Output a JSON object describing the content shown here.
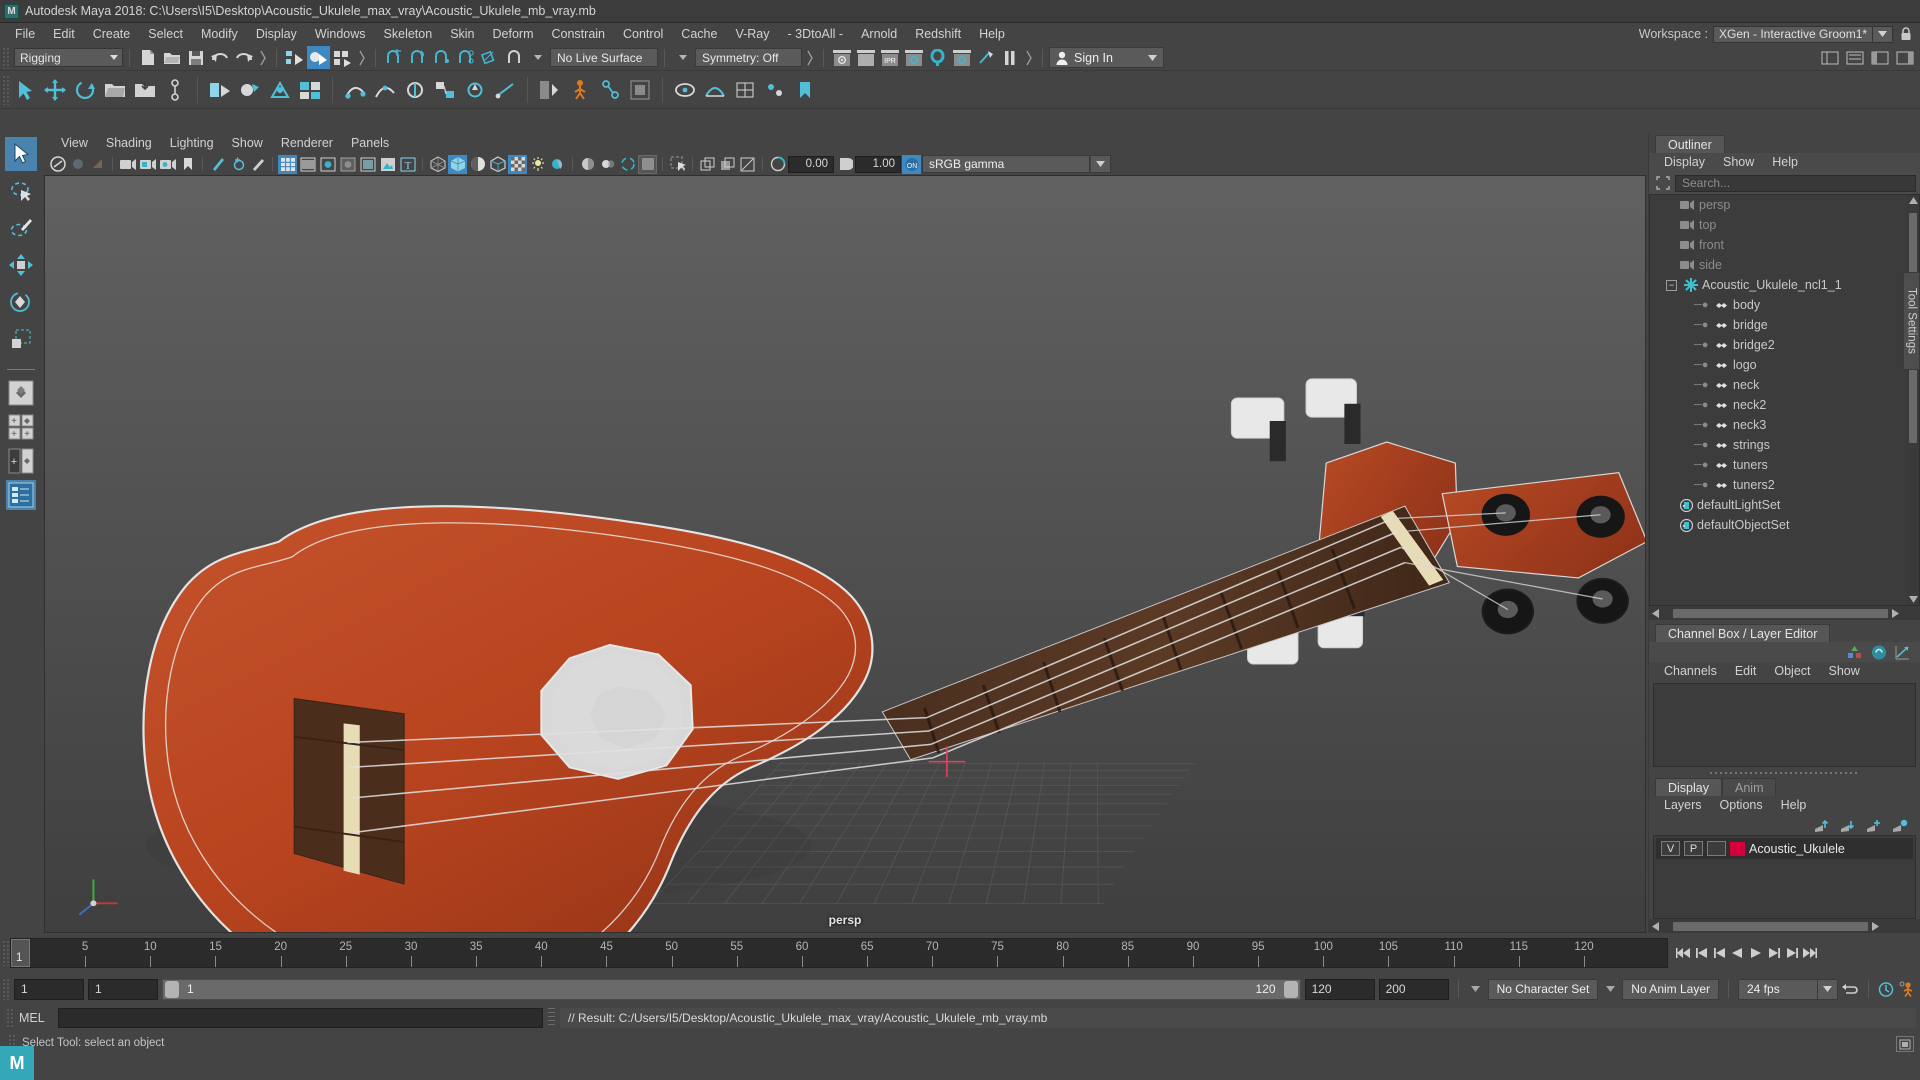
{
  "window": {
    "title": "Autodesk Maya 2018: C:\\Users\\I5\\Desktop\\Acoustic_Ukulele_max_vray\\Acoustic_Ukulele_mb_vray.mb",
    "logo_text": "M"
  },
  "menubar": {
    "items": [
      "File",
      "Edit",
      "Create",
      "Select",
      "Modify",
      "Display",
      "Windows",
      "Skeleton",
      "Skin",
      "Deform",
      "Constrain",
      "Control",
      "Cache",
      "V-Ray",
      "- 3DtoAll -",
      "Arnold",
      "Redshift",
      "Help"
    ],
    "workspace_label": "Workspace :",
    "workspace_value": "XGen - Interactive Groom1*"
  },
  "statusline": {
    "mode": "Rigging",
    "live_surface": "No Live Surface",
    "symmetry": "Symmetry: Off",
    "signin": "Sign In"
  },
  "viewport_menu": {
    "items": [
      "View",
      "Shading",
      "Lighting",
      "Show",
      "Renderer",
      "Panels"
    ],
    "exposure": "0.00",
    "gamma_value": "1.00",
    "color_profile": "sRGB gamma",
    "camera_label": "persp"
  },
  "outliner": {
    "tab": "Outliner",
    "menu": [
      "Display",
      "Show",
      "Help"
    ],
    "search_placeholder": "Search...",
    "items": [
      {
        "label": "persp",
        "type": "camera",
        "indent": 1,
        "dim": true
      },
      {
        "label": "top",
        "type": "camera",
        "indent": 1,
        "dim": true
      },
      {
        "label": "front",
        "type": "camera",
        "indent": 1,
        "dim": true
      },
      {
        "label": "side",
        "type": "camera",
        "indent": 1,
        "dim": true
      },
      {
        "label": "Acoustic_Ukulele_ncl1_1",
        "type": "group",
        "indent": 0,
        "dim": false
      },
      {
        "label": "body",
        "type": "mesh",
        "indent": 2,
        "dim": false
      },
      {
        "label": "bridge",
        "type": "mesh",
        "indent": 2,
        "dim": false
      },
      {
        "label": "bridge2",
        "type": "mesh",
        "indent": 2,
        "dim": false
      },
      {
        "label": "logo",
        "type": "mesh",
        "indent": 2,
        "dim": false
      },
      {
        "label": "neck",
        "type": "mesh",
        "indent": 2,
        "dim": false
      },
      {
        "label": "neck2",
        "type": "mesh",
        "indent": 2,
        "dim": false
      },
      {
        "label": "neck3",
        "type": "mesh",
        "indent": 2,
        "dim": false
      },
      {
        "label": "strings",
        "type": "mesh",
        "indent": 2,
        "dim": false
      },
      {
        "label": "tuners",
        "type": "mesh",
        "indent": 2,
        "dim": false
      },
      {
        "label": "tuners2",
        "type": "mesh",
        "indent": 2,
        "dim": false
      },
      {
        "label": "defaultLightSet",
        "type": "set",
        "indent": 1,
        "dim": false
      },
      {
        "label": "defaultObjectSet",
        "type": "set",
        "indent": 1,
        "dim": false
      }
    ]
  },
  "channelbox": {
    "tab": "Channel Box / Layer Editor",
    "menu": [
      "Channels",
      "Edit",
      "Object",
      "Show"
    ]
  },
  "layers": {
    "tabs": [
      "Display",
      "Anim"
    ],
    "active_tab": "Display",
    "menu": [
      "Layers",
      "Options",
      "Help"
    ],
    "rows": [
      {
        "v": "V",
        "p": "P",
        "color": "#d4003c",
        "name": "Acoustic_Ukulele"
      }
    ]
  },
  "tool_settings_tab": "Tool Settings",
  "timeline": {
    "current_frame": "1",
    "ticks": [
      5,
      10,
      15,
      20,
      25,
      30,
      35,
      40,
      45,
      50,
      55,
      60,
      65,
      70,
      75,
      80,
      85,
      90,
      95,
      100,
      105,
      110,
      115,
      120
    ],
    "start": 1,
    "end": 120
  },
  "range": {
    "start_field": "1",
    "anim_start_field": "1",
    "slider_min": "1",
    "slider_max": "120",
    "anim_end_field": "120",
    "end_field": "200",
    "character_set": "No Character Set",
    "anim_layer": "No Anim Layer",
    "fps": "24 fps"
  },
  "command_line": {
    "label": "MEL",
    "input_value": "",
    "result": "// Result: C:/Users/I5/Desktop/Acoustic_Ukulele_max_vray/Acoustic_Ukulele_mb_vray.mb"
  },
  "statusbar": {
    "text": "Select Tool: select an object"
  },
  "colors": {
    "accent": "#3f89c2",
    "teal": "#34a8b8",
    "layer_red": "#d4003c",
    "panel_bg": "#444444"
  }
}
